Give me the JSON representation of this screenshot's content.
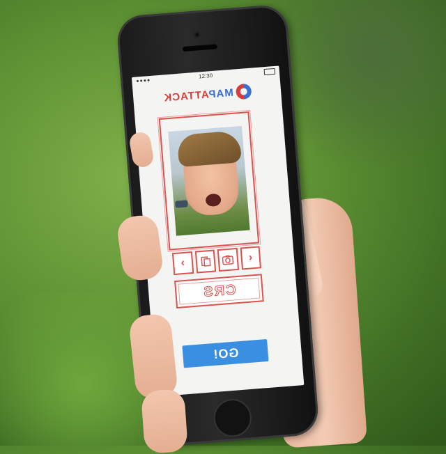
{
  "app": {
    "logo_map": "MAP",
    "logo_attack": "ATTACK"
  },
  "statusbar": {
    "time": "12:30"
  },
  "controls": {
    "prev": "‹",
    "next": "›"
  },
  "name_field": {
    "value": "CRS"
  },
  "go_button": {
    "label": "GO!"
  },
  "colors": {
    "accent_red": "#d9534f",
    "accent_blue": "#3b8fe0",
    "logo_blue": "#3b6fd1"
  },
  "icons": [
    "camera-flip-icon",
    "camera-icon",
    "chevron-left-icon",
    "chevron-right-icon"
  ]
}
